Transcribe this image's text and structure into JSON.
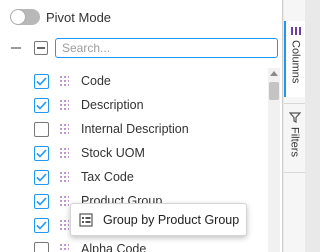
{
  "pivot": {
    "label": "Pivot Mode",
    "enabled": false
  },
  "search": {
    "placeholder": "Search..."
  },
  "columns": [
    {
      "label": "Code",
      "checked": true
    },
    {
      "label": "Description",
      "checked": true
    },
    {
      "label": "Internal Description",
      "checked": false
    },
    {
      "label": "Stock UOM",
      "checked": true
    },
    {
      "label": "Tax Code",
      "checked": true
    },
    {
      "label": "Product Group",
      "checked": true
    },
    {
      "label": "",
      "checked": true
    },
    {
      "label": "Alpha Code",
      "checked": false
    }
  ],
  "sidebar": {
    "columns_label": "Columns",
    "filters_label": "Filters"
  },
  "drag_tooltip": {
    "label": "Group by Product Group"
  },
  "colors": {
    "accent": "#2196f3",
    "drag_handle": "#b98fcf"
  }
}
